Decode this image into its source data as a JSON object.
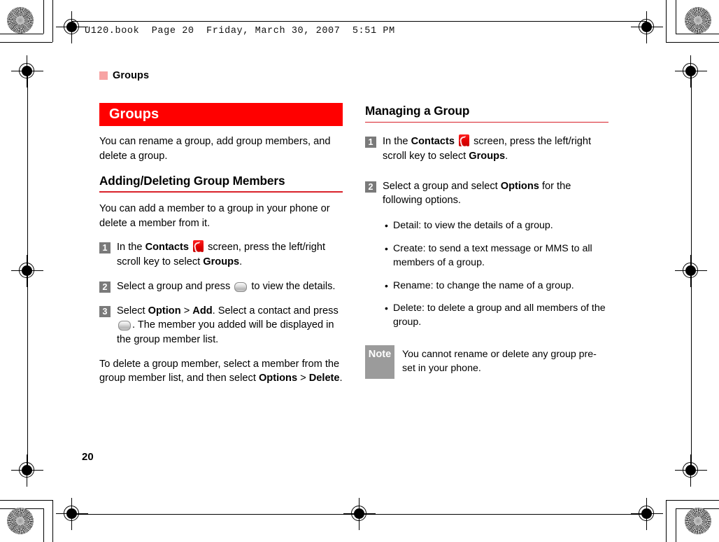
{
  "print_header": {
    "book_line": "U120.book  Page 20  Friday, March 30, 2007  5:51 PM"
  },
  "running_head": {
    "label": "Groups",
    "marker_color": "#f7a3a3"
  },
  "folio": {
    "page_number": "20"
  },
  "colors": {
    "banner_red": "#ff0000",
    "rule_red": "#d9222a",
    "step_badge_gray": "#7a7a7a",
    "note_gray": "#9b9b9b"
  },
  "left_column": {
    "banner_title": "Groups",
    "intro": "You can rename a group, add group members, and delete a group.",
    "section_title": "Adding/Deleting Group Members",
    "section_intro": "You can add a member to a group in your phone or delete a member from it.",
    "steps": [
      {
        "number": "1",
        "parts": [
          {
            "type": "text",
            "value": "In the "
          },
          {
            "type": "bold",
            "value": "Contacts"
          },
          {
            "type": "text",
            "value": " "
          },
          {
            "type": "icon",
            "value": "contacts-icon"
          },
          {
            "type": "text",
            "value": " screen, press the left/right scroll key to select "
          },
          {
            "type": "bold",
            "value": "Groups"
          },
          {
            "type": "text",
            "value": "."
          }
        ]
      },
      {
        "number": "2",
        "parts": [
          {
            "type": "text",
            "value": "Select a group and press "
          },
          {
            "type": "icon",
            "value": "ok-key-icon"
          },
          {
            "type": "text",
            "value": " to view the details."
          }
        ]
      },
      {
        "number": "3",
        "parts": [
          {
            "type": "text",
            "value": "Select "
          },
          {
            "type": "bold",
            "value": "Option"
          },
          {
            "type": "text",
            "value": " > "
          },
          {
            "type": "bold",
            "value": "Add"
          },
          {
            "type": "text",
            "value": ". Select a contact and press "
          },
          {
            "type": "icon",
            "value": "ok-key-icon"
          },
          {
            "type": "text",
            "value": ". The member you added will be displayed in the group member list."
          }
        ]
      }
    ],
    "closing_paragraph": {
      "parts": [
        {
          "type": "text",
          "value": "To delete a group member, select a member from the group member list, and then select "
        },
        {
          "type": "bold",
          "value": "Options"
        },
        {
          "type": "text",
          "value": " > "
        },
        {
          "type": "bold",
          "value": "Delete"
        },
        {
          "type": "text",
          "value": "."
        }
      ]
    }
  },
  "right_column": {
    "section_title": "Managing a Group",
    "steps": [
      {
        "number": "1",
        "parts": [
          {
            "type": "text",
            "value": "In the "
          },
          {
            "type": "bold",
            "value": "Contacts"
          },
          {
            "type": "text",
            "value": " "
          },
          {
            "type": "icon",
            "value": "contacts-icon"
          },
          {
            "type": "text",
            "value": " screen, press the left/right scroll key to select "
          },
          {
            "type": "bold",
            "value": "Groups"
          },
          {
            "type": "text",
            "value": "."
          }
        ]
      },
      {
        "number": "2",
        "parts": [
          {
            "type": "text",
            "value": "Select a group and select "
          },
          {
            "type": "bold",
            "value": "Options"
          },
          {
            "type": "text",
            "value": " for the following options."
          }
        ]
      }
    ],
    "bullets": [
      "Detail: to view the details of a group.",
      "Create: to send a text message or MMS to all members of a group.",
      "Rename: to change the name of a group.",
      "Delete: to delete a group and all members of the group."
    ],
    "note": {
      "tag": "Note",
      "text": "You cannot rename or delete any group pre-set in your phone."
    }
  }
}
